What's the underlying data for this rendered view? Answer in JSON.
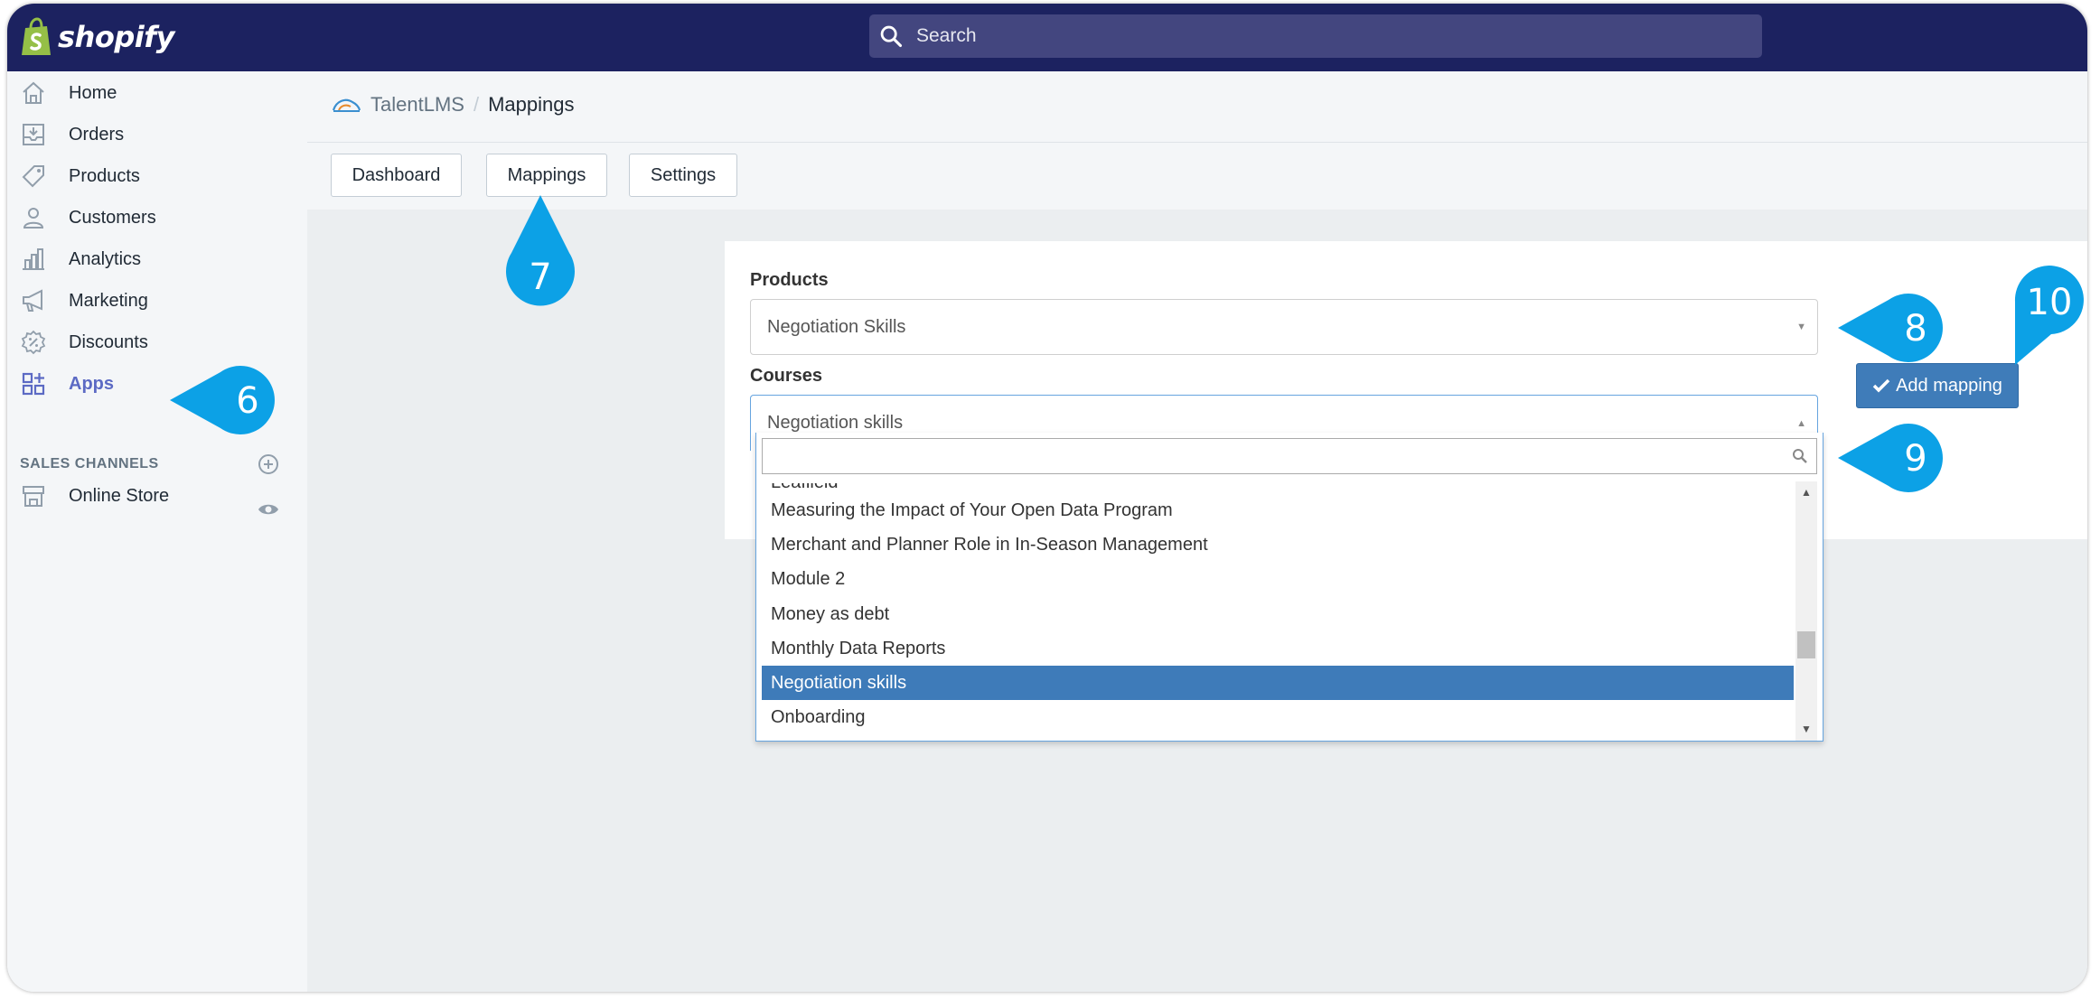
{
  "topbar": {
    "brand": "shopify",
    "search_placeholder": "Search"
  },
  "sidebar": {
    "items": [
      {
        "label": "Home",
        "icon": "home-icon"
      },
      {
        "label": "Orders",
        "icon": "orders-icon"
      },
      {
        "label": "Products",
        "icon": "tag-icon"
      },
      {
        "label": "Customers",
        "icon": "person-icon"
      },
      {
        "label": "Analytics",
        "icon": "bar-chart-icon"
      },
      {
        "label": "Marketing",
        "icon": "megaphone-icon"
      },
      {
        "label": "Discounts",
        "icon": "discount-icon"
      },
      {
        "label": "Apps",
        "icon": "apps-icon",
        "active": true
      }
    ],
    "sales_channels_heading": "SALES CHANNELS",
    "channels": [
      {
        "label": "Online Store",
        "icon": "store-icon"
      }
    ]
  },
  "breadcrumb": {
    "app": "TalentLMS",
    "separator": "/",
    "page": "Mappings"
  },
  "tabs": [
    {
      "label": "Dashboard"
    },
    {
      "label": "Mappings"
    },
    {
      "label": "Settings"
    }
  ],
  "form": {
    "products_label": "Products",
    "products_value": "Negotiation Skills",
    "courses_label": "Courses",
    "courses_value": "Negotiation skills",
    "add_button": "Add mapping"
  },
  "dropdown": {
    "search_value": "",
    "partial_option": "Leaflield",
    "options": [
      "Measuring the Impact of Your Open Data Program",
      "Merchant and Planner Role in In-Season Management",
      "Module 2",
      "Money as debt",
      "Monthly Data Reports",
      "Negotiation skills",
      "Onboarding"
    ],
    "selected": "Negotiation skills"
  },
  "callouts": [
    "6",
    "7",
    "8",
    "9",
    "10"
  ],
  "colors": {
    "topbar": "#1c2260",
    "accent": "#5c6ac4",
    "callout": "#0ca1e6",
    "selected_option": "#3e7bb9",
    "add_button": "#3f7cb9"
  }
}
